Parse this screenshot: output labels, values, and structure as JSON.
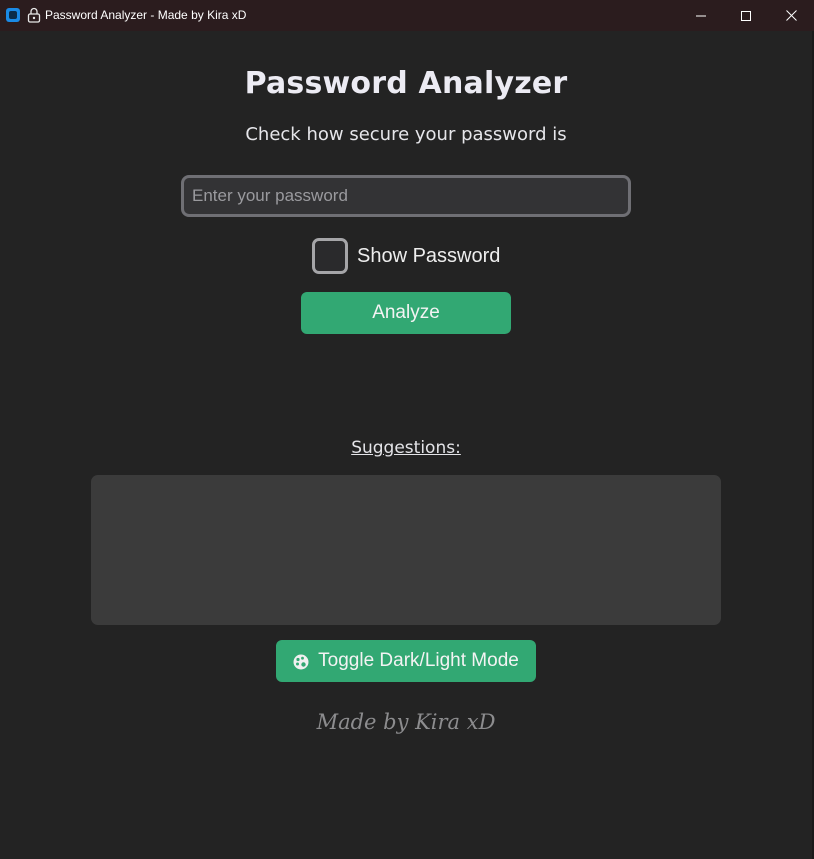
{
  "window": {
    "title": "Password Analyzer - Made by Kira xD",
    "icon": "app-icon",
    "title_icon": "lock-emoji-icon",
    "controls": [
      "minimize-icon",
      "maximize-icon",
      "close-icon"
    ]
  },
  "main": {
    "heading": "Password Analyzer",
    "subheading": "Check how secure your password is",
    "password_input": {
      "placeholder": "Enter your password",
      "value": ""
    },
    "show_password": {
      "label": "Show Password",
      "checked": false
    },
    "analyze_label": "Analyze",
    "suggestions_label": "Suggestions:",
    "suggestions_text": "",
    "toggle_label": "Toggle Dark/Light Mode",
    "toggle_icon": "palette-icon",
    "footer": "Made by Kira xD"
  },
  "colors": {
    "background": "#232323",
    "titlebar": "#2b1c1e",
    "accent": "#32a873",
    "input_bg": "#333335",
    "suggestions_bg": "#3b3b3b",
    "text": "#ecebf3",
    "footer_text": "#8c8c8e"
  }
}
